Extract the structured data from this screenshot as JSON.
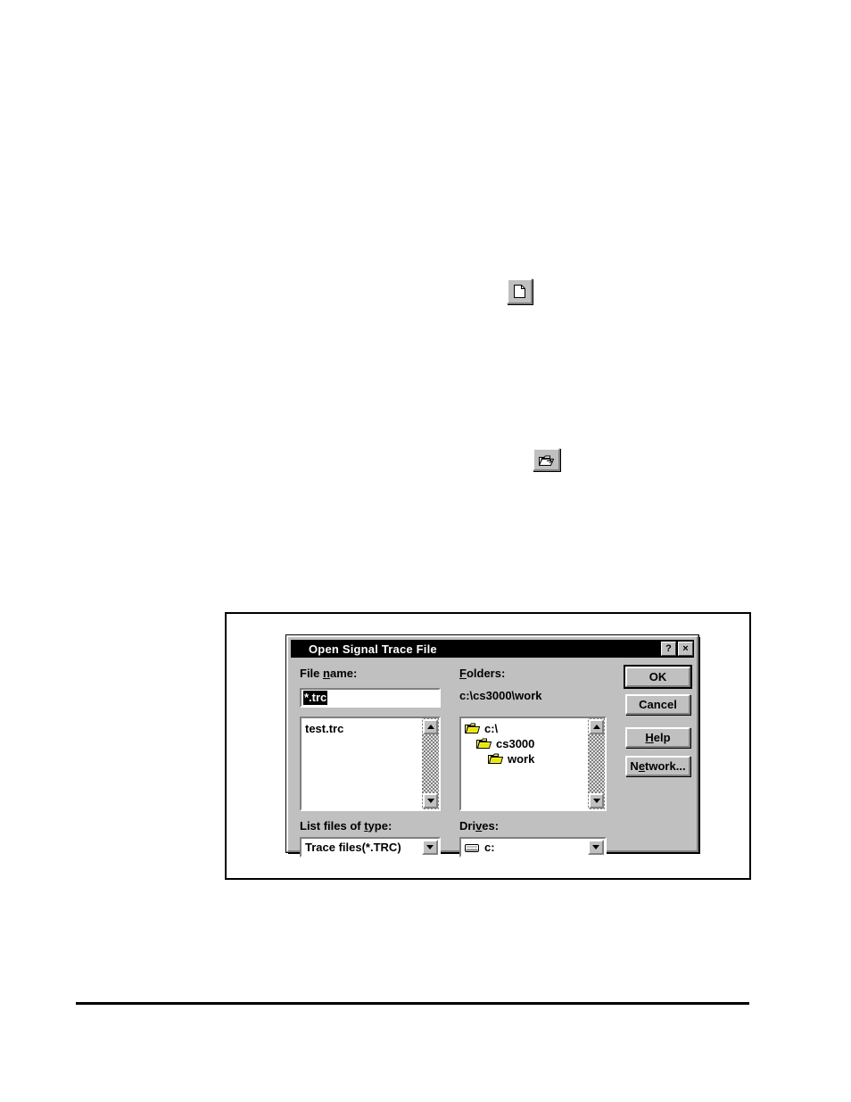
{
  "page": {
    "toolbar_icons": [
      {
        "name": "new-document-icon",
        "glyph": "document"
      },
      {
        "name": "open-folder-icon",
        "glyph": "open-folder"
      }
    ]
  },
  "dialog": {
    "title": "Open Signal Trace File",
    "titlebar_buttons": [
      {
        "name": "help-titlebar-button",
        "label": "?"
      },
      {
        "name": "close-titlebar-button",
        "label": "×"
      }
    ],
    "file_name": {
      "label_prefix": "File ",
      "label_accel": "n",
      "label_suffix": "ame:",
      "label": "File name:",
      "value": "*.trc",
      "selected": true
    },
    "file_list": {
      "items": [
        "test.trc"
      ]
    },
    "folders": {
      "label_accel": "F",
      "label_suffix": "olders:",
      "label": "Folders:",
      "current_path": "c:\\cs3000\\work",
      "items": [
        {
          "name": "c:\\",
          "depth": 0
        },
        {
          "name": "cs3000",
          "depth": 1
        },
        {
          "name": "work",
          "depth": 2
        }
      ]
    },
    "list_files_of_type": {
      "label_prefix": "List files of ",
      "label_accel": "t",
      "label_suffix": "ype:",
      "label": "List files of type:",
      "value": "Trace files(*.TRC)"
    },
    "drives": {
      "label_prefix": "Dri",
      "label_accel": "v",
      "label_suffix": "es:",
      "label": "Drives:",
      "value": "c:"
    },
    "buttons": [
      {
        "name": "ok-button",
        "label": "OK",
        "accel": "",
        "default": true
      },
      {
        "name": "cancel-button",
        "label": "Cancel",
        "accel": "",
        "default": false
      },
      {
        "name": "help-button",
        "label": "Help",
        "accel": "H",
        "default": false
      },
      {
        "name": "network-button",
        "label": "Network...",
        "accel": "e",
        "default": false
      }
    ]
  },
  "colors": {
    "face": "#c0c0c0",
    "shadow": "#808080",
    "highlight": "#ffffff",
    "titlebar_bg": "#000000",
    "titlebar_fg": "#ffffff",
    "folder_yellow": "#ffff80",
    "folder_shade": "#c8c800"
  }
}
